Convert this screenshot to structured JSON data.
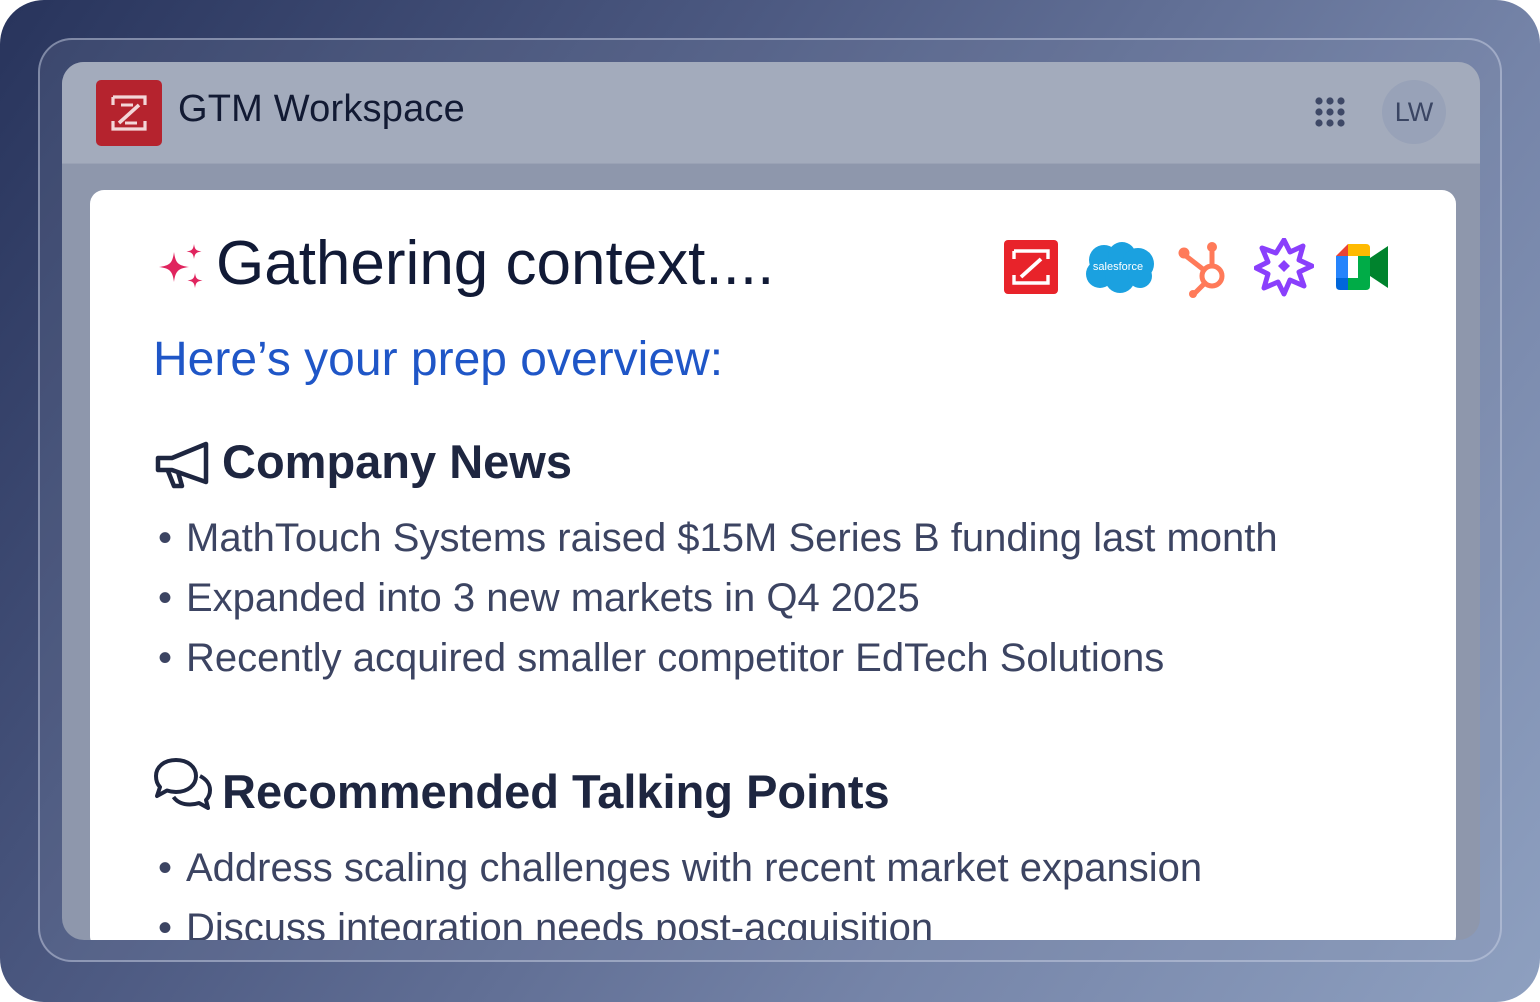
{
  "app": {
    "title": "GTM Workspace",
    "logo_icon": "zoominfo-logo-icon",
    "apps_icon": "apps-grid-icon",
    "avatar_initials": "LW"
  },
  "card": {
    "status_icon": "sparkle-icon",
    "status_text": "Gathering context....",
    "integrations": [
      {
        "name": "zoominfo",
        "icon": "zoominfo-icon",
        "color": "#e8232a"
      },
      {
        "name": "salesforce",
        "icon": "salesforce-icon",
        "label": "salesforce",
        "color": "#1ba1e0"
      },
      {
        "name": "hubspot",
        "icon": "hubspot-icon",
        "color": "#ff7a59"
      },
      {
        "name": "gong",
        "icon": "gong-icon",
        "color": "#8a3ffc"
      },
      {
        "name": "google-meet",
        "icon": "google-meet-icon",
        "color": "#00ac47"
      }
    ],
    "overview_heading": "Here’s your prep overview:",
    "sections": [
      {
        "icon": "megaphone-icon",
        "title": "Company News",
        "bullets": [
          "MathTouch Systems raised $15M Series B funding last month",
          "Expanded into 3 new markets in Q4 2025",
          "Recently acquired smaller competitor EdTech Solutions"
        ]
      },
      {
        "icon": "chat-bubbles-icon",
        "title": "Recommended Talking Points",
        "bullets": [
          "Address scaling challenges with recent market expansion",
          "Discuss integration needs post-acquisition"
        ]
      }
    ]
  },
  "colors": {
    "accent_blue": "#1f56c7",
    "brand_red": "#b5232e",
    "sparkle_pink": "#e0245e"
  }
}
